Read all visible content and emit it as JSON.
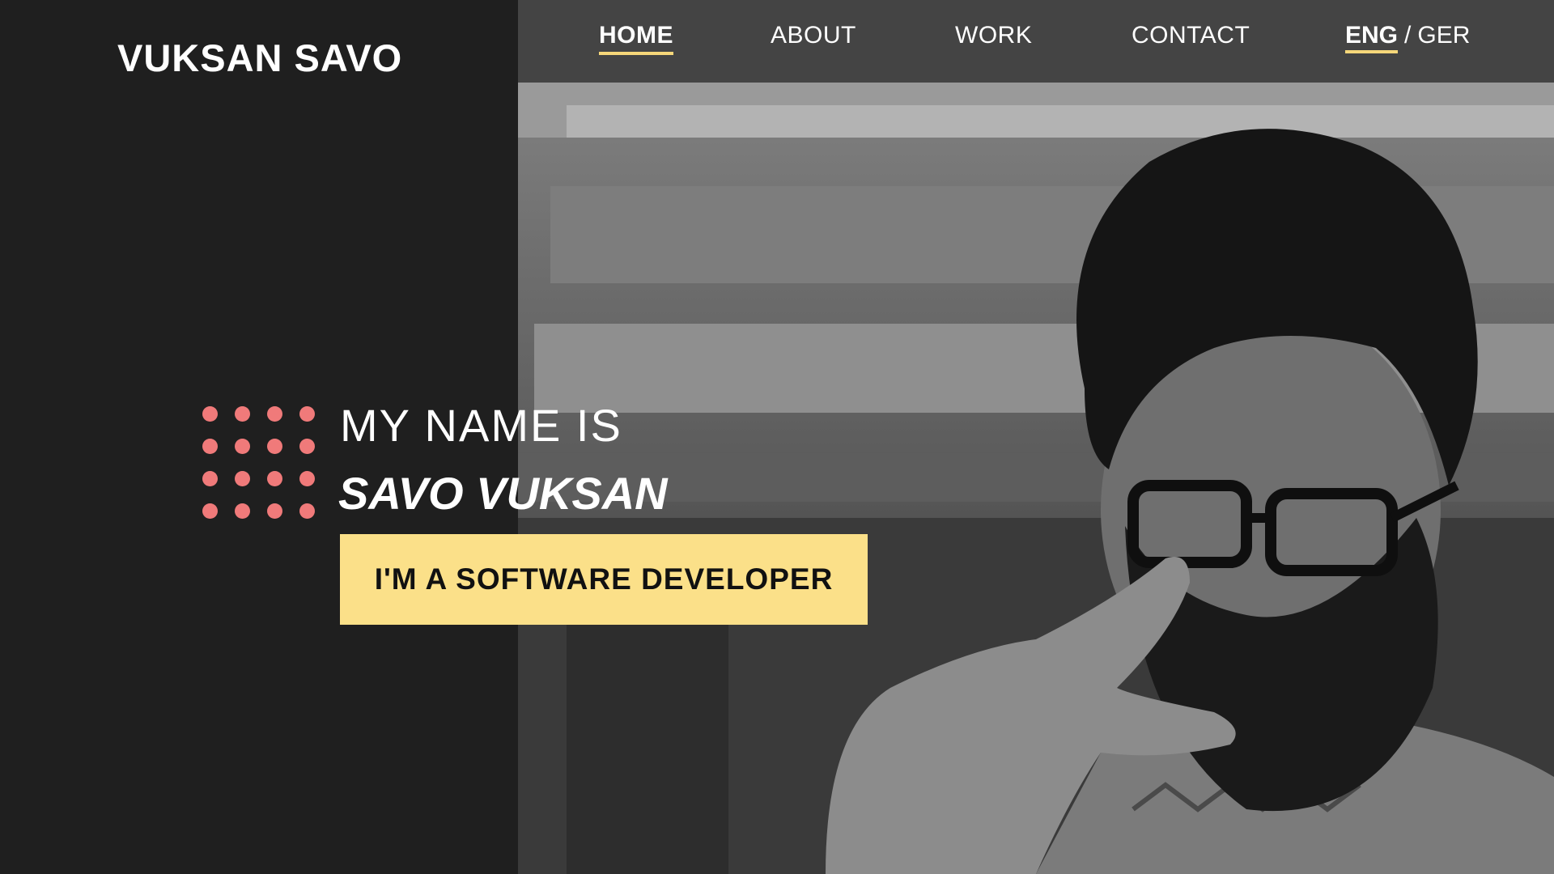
{
  "logo": {
    "text": "VUKSAN SAVO"
  },
  "nav": {
    "items": [
      {
        "label": "HOME",
        "active": true
      },
      {
        "label": "ABOUT",
        "active": false
      },
      {
        "label": "WORK",
        "active": false
      },
      {
        "label": "CONTACT",
        "active": false
      }
    ],
    "language": {
      "eng": "ENG",
      "separator": "/",
      "ger": "GER",
      "selected": "ENG"
    }
  },
  "hero": {
    "intro": "MY NAME IS",
    "name": "SAVO VUKSAN",
    "tagline": "I'M A SOFTWARE DEVELOPER"
  },
  "colors": {
    "accent": "#fbe089",
    "underline": "#f6d77a",
    "dots": "#f07a7a",
    "left_panel": "#1f1f1f",
    "nav_bar": "#444444"
  },
  "icons": {
    "decor": "dot-grid-icon",
    "photo": "portrait-photo"
  }
}
